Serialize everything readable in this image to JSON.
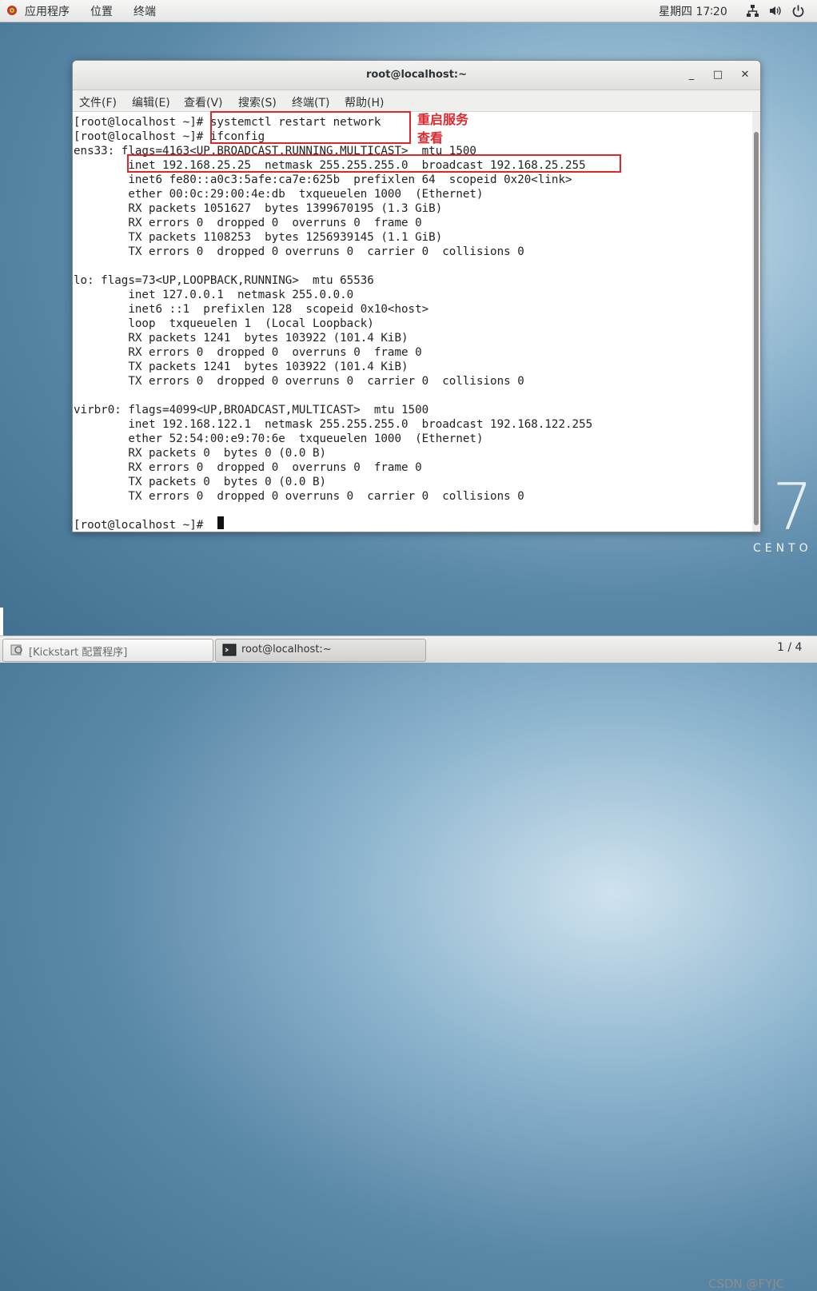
{
  "topbar": {
    "applications": "应用程序",
    "places": "位置",
    "terminal": "终端",
    "clock": "星期四 17∶20"
  },
  "desktop": {
    "centos_number": "7",
    "centos_text": "CENTO"
  },
  "window": {
    "title": "root@localhost:~",
    "minimize": "_",
    "maximize": "□",
    "close": "✕",
    "menu": [
      "文件(F)",
      "编辑(E)",
      "查看(V)",
      "搜索(S)",
      "终端(T)",
      "帮助(H)"
    ]
  },
  "terminal": {
    "lines": [
      "[root@localhost ~]# systemctl restart network",
      "[root@localhost ~]# ifconfig",
      "ens33: flags=4163<UP,BROADCAST,RUNNING,MULTICAST>  mtu 1500",
      "        inet 192.168.25.25  netmask 255.255.255.0  broadcast 192.168.25.255",
      "        inet6 fe80::a0c3:5afe:ca7e:625b  prefixlen 64  scopeid 0x20<link>",
      "        ether 00:0c:29:00:4e:db  txqueuelen 1000  (Ethernet)",
      "        RX packets 1051627  bytes 1399670195 (1.3 GiB)",
      "        RX errors 0  dropped 0  overruns 0  frame 0",
      "        TX packets 1108253  bytes 1256939145 (1.1 GiB)",
      "        TX errors 0  dropped 0 overruns 0  carrier 0  collisions 0",
      "",
      "lo: flags=73<UP,LOOPBACK,RUNNING>  mtu 65536",
      "        inet 127.0.0.1  netmask 255.0.0.0",
      "        inet6 ::1  prefixlen 128  scopeid 0x10<host>",
      "        loop  txqueuelen 1  (Local Loopback)",
      "        RX packets 1241  bytes 103922 (101.4 KiB)",
      "        RX errors 0  dropped 0  overruns 0  frame 0",
      "        TX packets 1241  bytes 103922 (101.4 KiB)",
      "        TX errors 0  dropped 0 overruns 0  carrier 0  collisions 0",
      "",
      "virbr0: flags=4099<UP,BROADCAST,MULTICAST>  mtu 1500",
      "        inet 192.168.122.1  netmask 255.255.255.0  broadcast 192.168.122.255",
      "        ether 52:54:00:e9:70:6e  txqueuelen 1000  (Ethernet)",
      "        RX packets 0  bytes 0 (0.0 B)",
      "        RX errors 0  dropped 0  overruns 0  frame 0",
      "        TX packets 0  bytes 0 (0.0 B)",
      "        TX errors 0  dropped 0 overruns 0  carrier 0  collisions 0",
      "",
      "[root@localhost ~]# "
    ]
  },
  "annotations": {
    "restart_label": "重启服务",
    "view_label": "查看",
    "color": "#e0262c"
  },
  "taskbar": {
    "task1": "[Kickstart 配置程序]",
    "task2": "root@localhost:~",
    "watermark": "CSDN @FYJC",
    "pager": "1 / 4"
  }
}
